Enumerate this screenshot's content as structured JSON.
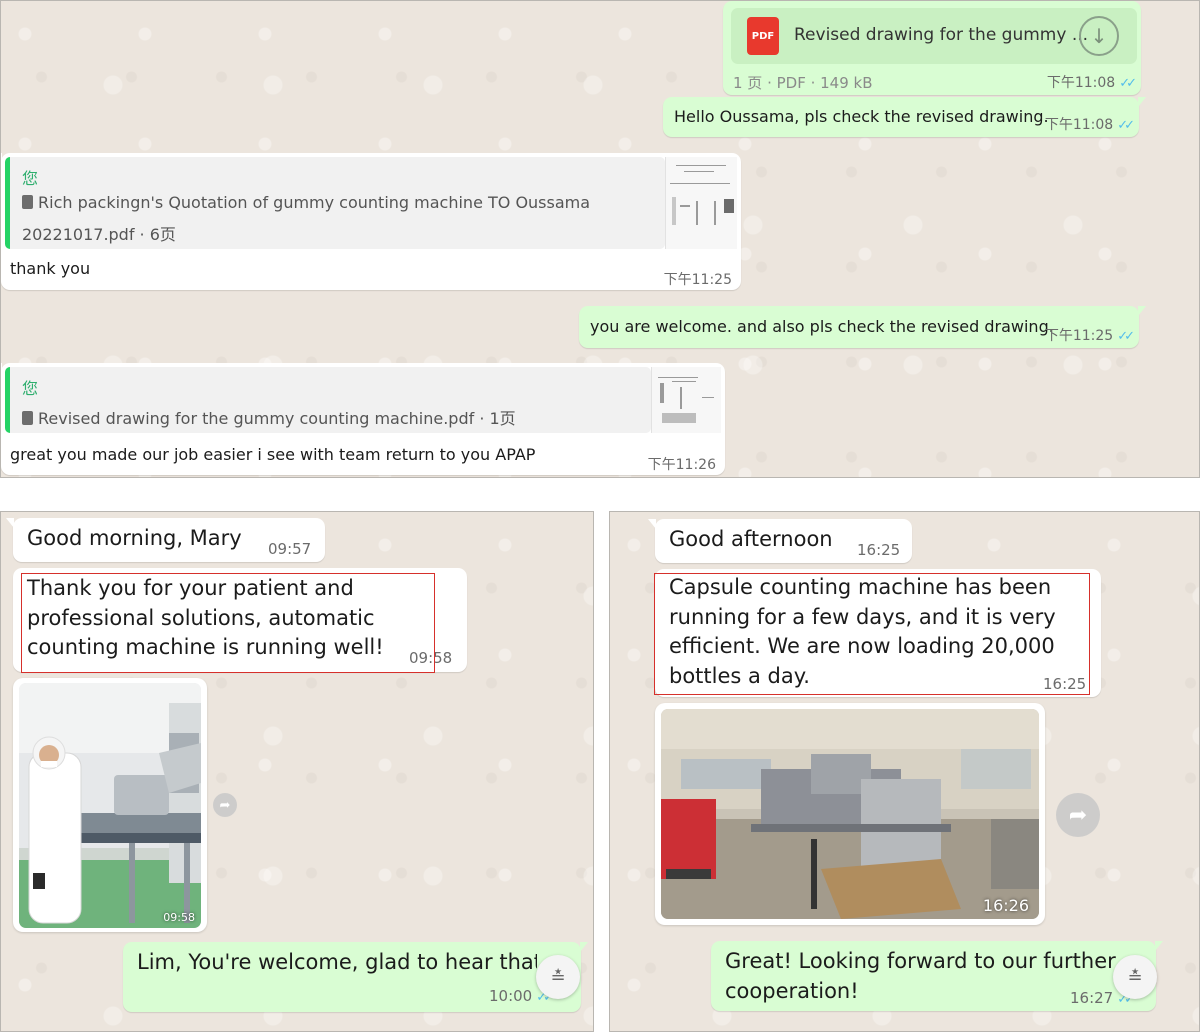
{
  "top": {
    "pdf_message": {
      "filename": "Revised drawing for the gummy ...",
      "pdf_icon": "PDF",
      "meta": "1 页 · PDF · 149 kB",
      "time": "下午11:08"
    },
    "msg_hello": {
      "text": "Hello Oussama, pls check the revised drawing.",
      "time": "下午11:08"
    },
    "reply_1": {
      "quote_name": "您",
      "quote_line1": "Rich packingn's Quotation of gummy counting machine TO Oussama",
      "quote_line2": "20221017.pdf · 6页",
      "text": "thank you",
      "time": "下午11:25"
    },
    "msg_welcome": {
      "text": "you are welcome. and also pls check the revised drawing.",
      "time": "下午11:25"
    },
    "reply_2": {
      "quote_name": "您",
      "quote_line1": "Revised drawing for the gummy counting machine.pdf · 1页",
      "text": "great you made our job easier i see with team return to you APAP",
      "time": "下午11:26"
    }
  },
  "left": {
    "greeting": {
      "text": "Good morning, Mary",
      "time": "09:57"
    },
    "thanks": {
      "text": "Thank you for your patient and professional solutions, automatic counting machine is running well!",
      "time": "09:58"
    },
    "photo": {
      "time": "09:58"
    },
    "reply": {
      "text": "Lim, You're welcome, glad to hear that",
      "time": "10:00"
    }
  },
  "right": {
    "greeting": {
      "text": "Good afternoon",
      "time": "16:25"
    },
    "feedback": {
      "text": "Capsule counting machine has been running for a few days, and it is very efficient. We are now loading 20,000 bottles a day.",
      "time": "16:25"
    },
    "photo": {
      "time": "16:26"
    },
    "reply": {
      "text": "Great! Looking forward to our further cooperation!",
      "time": "16:27"
    }
  },
  "colors": {
    "outgoing_bubble": "#d9fdd3",
    "incoming_bubble": "#ffffff",
    "chat_background": "#ece5dd",
    "quote_accent": "#25d366",
    "read_ticks": "#53bdeb",
    "highlight_box": "#d6302b"
  },
  "icons": [
    "pdf-icon",
    "download-icon",
    "document-icon",
    "double-check-icon",
    "forward-icon",
    "scroll-down-icon"
  ]
}
